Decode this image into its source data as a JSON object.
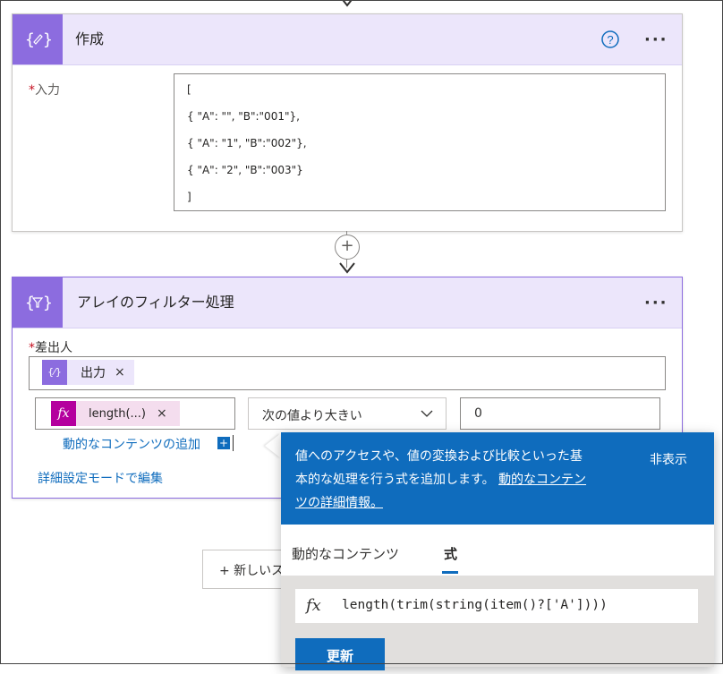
{
  "compose": {
    "title": "作成",
    "input_label": "入力",
    "required_mark": "*",
    "input_lines": [
      "[",
      "{ \"A\": \"\", \"B\":\"001\"},",
      "{ \"A\": \"1\", \"B\":\"002\"},",
      "{ \"A\": \"2\", \"B\":\"003\"}",
      "]"
    ],
    "help_icon": "?",
    "more_icon": "···"
  },
  "filter": {
    "title": "アレイのフィルター処理",
    "from_label": "差出人",
    "required_mark": "*",
    "from_token": {
      "label": "出力",
      "remove": "×"
    },
    "condition_token": {
      "label": "length(...)",
      "remove": "×",
      "icon_text": "fx"
    },
    "operator": "次の値より大きい",
    "value": "0",
    "add_dynamic": "動的なコンテンツの追加",
    "advanced_mode": "詳細設定モードで編集",
    "more_icon": "···"
  },
  "connector": {
    "plus": "+"
  },
  "new_step": {
    "label": "+ 新しいス"
  },
  "popup": {
    "description": "値へのアクセスや、値の変換および比較といった基本的な処理を行う式を追加します。",
    "desc_line1": "値へのアクセスや、値の変換および比較といった基",
    "desc_line2a": "本的な処理を行う式を追加します。",
    "link_part1": "動的なコンテン",
    "link_part2": "ツの詳細情報。",
    "hide_label": "非表示",
    "tabs": [
      {
        "label": "動的なコンテンツ",
        "active": false
      },
      {
        "label": "式",
        "active": true
      }
    ],
    "fx_label": "fx",
    "expression": "length(trim(string(item()?['A'])))",
    "update_button": "更新"
  },
  "colors": {
    "accent": "#0f6cbd",
    "header_bg": "#ece6fb",
    "icon_bg": "#8c6cdf",
    "expr_token": "#b4009e"
  }
}
